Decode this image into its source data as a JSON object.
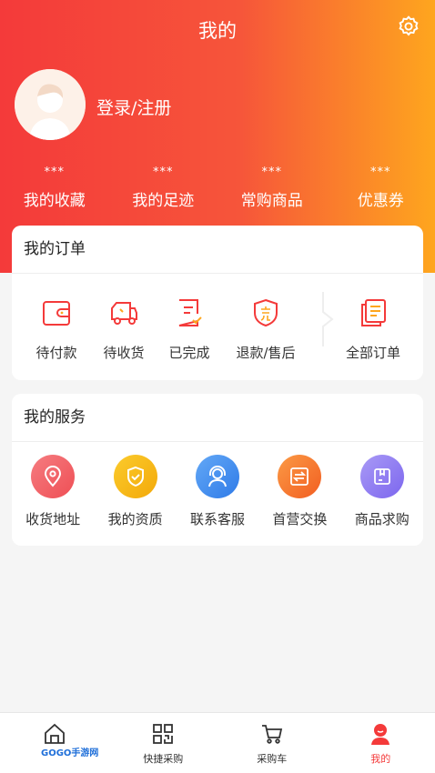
{
  "header": {
    "title": "我的",
    "login_text": "登录/注册"
  },
  "stats": [
    {
      "value": "***",
      "label": "我的收藏"
    },
    {
      "value": "***",
      "label": "我的足迹"
    },
    {
      "value": "***",
      "label": "常购商品"
    },
    {
      "value": "***",
      "label": "优惠券"
    }
  ],
  "orders": {
    "title": "我的订单",
    "items": [
      {
        "label": "待付款",
        "icon": "wallet-icon"
      },
      {
        "label": "待收货",
        "icon": "truck-icon"
      },
      {
        "label": "已完成",
        "icon": "document-check-icon"
      },
      {
        "label": "退款/售后",
        "icon": "shield-sale-icon"
      },
      {
        "label": "全部订单",
        "icon": "orders-list-icon"
      }
    ]
  },
  "services": {
    "title": "我的服务",
    "items": [
      {
        "label": "收货地址",
        "icon": "location-pin-icon",
        "color": "#f05a5f"
      },
      {
        "label": "我的资质",
        "icon": "shield-check-icon",
        "color": "#f7b500"
      },
      {
        "label": "联系客服",
        "icon": "headset-icon",
        "color": "#3d8ef0"
      },
      {
        "label": "首营交换",
        "icon": "exchange-icon",
        "color": "#f97930"
      },
      {
        "label": "商品求购",
        "icon": "box-icon",
        "color": "#8e7cf0"
      }
    ]
  },
  "tabbar": {
    "items": [
      {
        "label": "首页",
        "icon": "home-icon"
      },
      {
        "label": "快捷采购",
        "icon": "qr-icon"
      },
      {
        "label": "采购车",
        "icon": "cart-icon"
      },
      {
        "label": "我的",
        "icon": "profile-icon",
        "active": true
      }
    ]
  },
  "watermark": "GOGO手游网",
  "colors": {
    "primary": "#f43a3a",
    "gradient_end": "#fea61e"
  }
}
